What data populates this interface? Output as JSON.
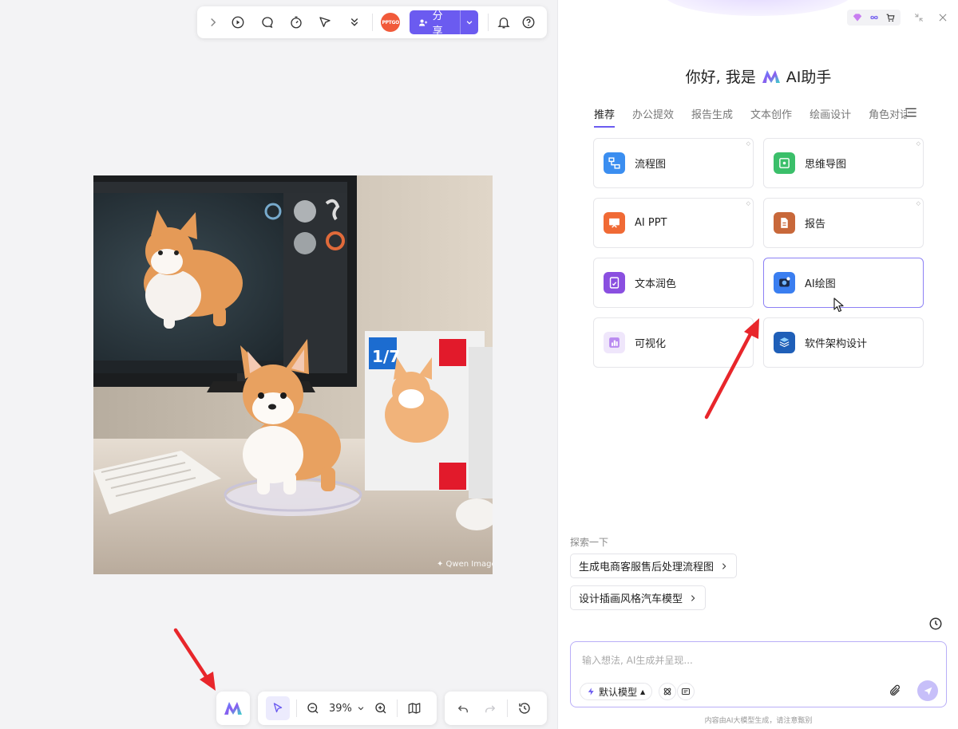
{
  "top_toolbar": {
    "pptgo_label": "PPTGO",
    "share_label": "分享"
  },
  "zoom": {
    "level": "39%"
  },
  "panel": {
    "greeting_prefix": "你好, 我是",
    "greeting_suffix": "AI助手",
    "tabs": [
      {
        "label": "推荐",
        "active": true
      },
      {
        "label": "办公提效"
      },
      {
        "label": "报告生成"
      },
      {
        "label": "文本创作"
      },
      {
        "label": "绘画设计"
      },
      {
        "label": "角色对话"
      }
    ],
    "cards": [
      {
        "label": "流程图",
        "icon": "flowchart-icon",
        "color": "#3b8ef0"
      },
      {
        "label": "思维导图",
        "icon": "mindmap-icon",
        "color": "#3bbf6a"
      },
      {
        "label": "AI PPT",
        "icon": "ppt-icon",
        "color": "#f06a35"
      },
      {
        "label": "报告",
        "icon": "report-icon",
        "color": "#c8683a"
      },
      {
        "label": "文本润色",
        "icon": "text-polish-icon",
        "color": "#8a4fe0"
      },
      {
        "label": "AI绘图",
        "icon": "ai-drawing-icon",
        "color": "#3a7ef0"
      },
      {
        "label": "可视化",
        "icon": "visualization-icon",
        "color": "#b98af0"
      },
      {
        "label": "软件架构设计",
        "icon": "architecture-icon",
        "color": "#1f5fb8"
      }
    ],
    "explore_title": "探索一下",
    "suggestions": [
      "生成电商客服售后处理流程图",
      "设计插画风格汽车模型"
    ],
    "input_placeholder": "输入想法, AI生成并呈现...",
    "model_label": "默认模型",
    "disclaimer": "内容由AI大模型生成，请注意甄别"
  },
  "colors": {
    "accent": "#6b5bf0",
    "arrow": "#e8262b"
  }
}
